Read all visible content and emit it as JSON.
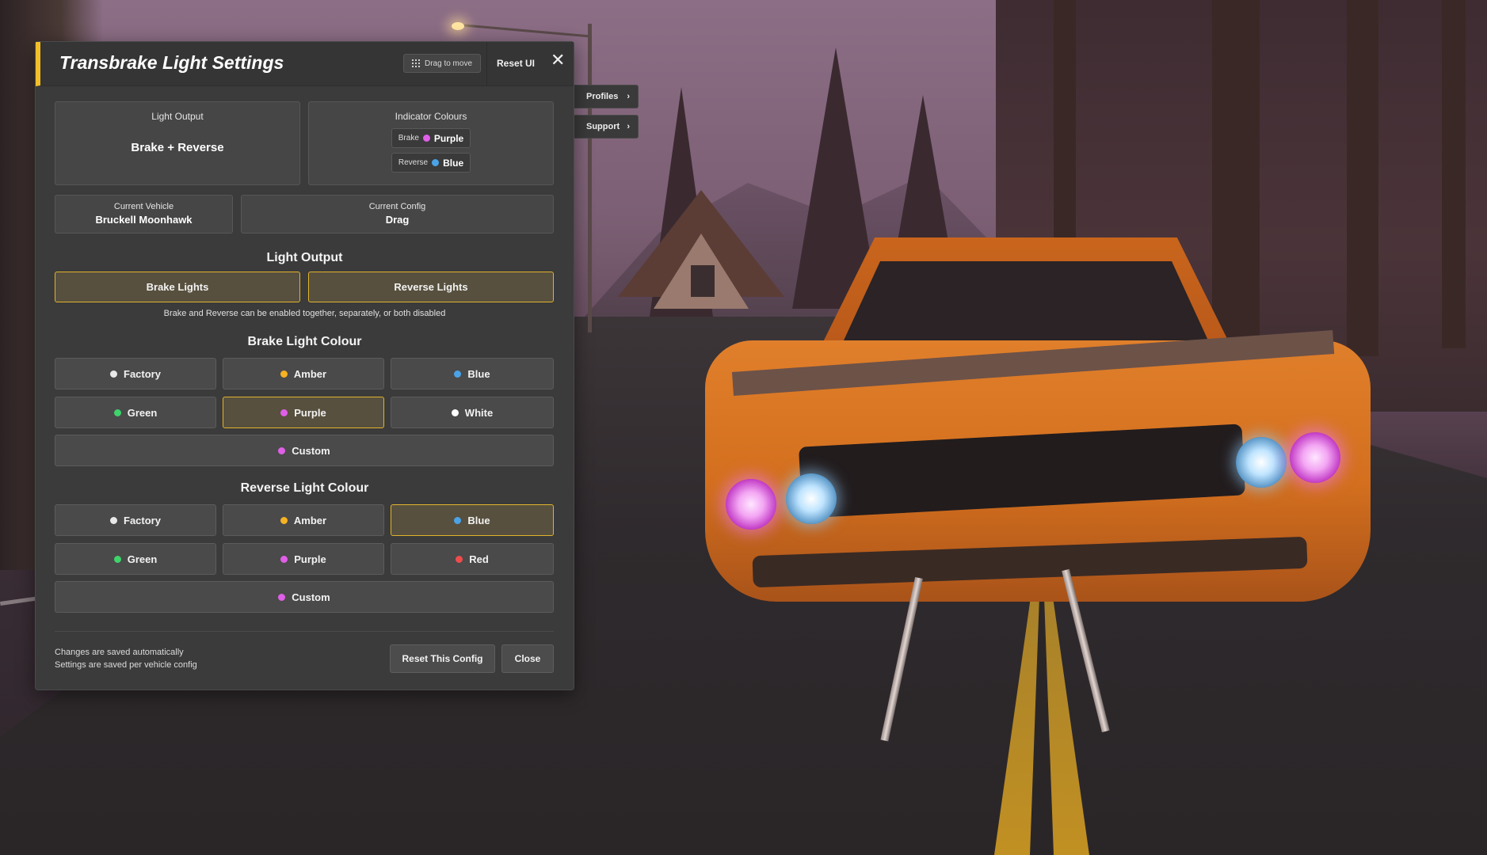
{
  "panel": {
    "title": "Transbrake Light Settings",
    "drag_label": "Drag to move",
    "reset_ui_label": "Reset UI",
    "close_icon": "✕"
  },
  "side_tabs": {
    "profiles": "Profiles",
    "support": "Support",
    "chevron": "›"
  },
  "summary": {
    "light_output_label": "Light Output",
    "light_output_value": "Brake + Reverse",
    "indicator_label": "Indicator Colours",
    "brake_label": "Brake",
    "brake_value": "Purple",
    "reverse_label": "Reverse",
    "reverse_value": "Blue",
    "vehicle_label": "Current Vehicle",
    "vehicle_value": "Bruckell Moonhawk",
    "config_label": "Current Config",
    "config_value": "Drag"
  },
  "light_output": {
    "title": "Light Output",
    "brake_button": "Brake Lights",
    "reverse_button": "Reverse Lights",
    "hint": "Brake and Reverse can be enabled together, separately, or both disabled"
  },
  "brake_colour": {
    "title": "Brake Light Colour",
    "options": [
      "Factory",
      "Amber",
      "Blue",
      "Green",
      "Purple",
      "White"
    ],
    "custom": "Custom",
    "selected": "Purple"
  },
  "reverse_colour": {
    "title": "Reverse Light Colour",
    "options": [
      "Factory",
      "Amber",
      "Blue",
      "Green",
      "Purple",
      "Red"
    ],
    "custom": "Custom",
    "selected": "Blue"
  },
  "colors": {
    "accent": "#f2bf2a",
    "factory": "#e8e8e8",
    "amber": "#f5b223",
    "blue": "#4aa3e8",
    "green": "#3dd46a",
    "purple": "#e05fe8",
    "white": "#ffffff",
    "red": "#ef4b4b"
  },
  "footer": {
    "note_line1": "Changes are saved automatically",
    "note_line2": "Settings are saved per vehicle config",
    "reset_config_button": "Reset This Config",
    "close_button": "Close"
  }
}
